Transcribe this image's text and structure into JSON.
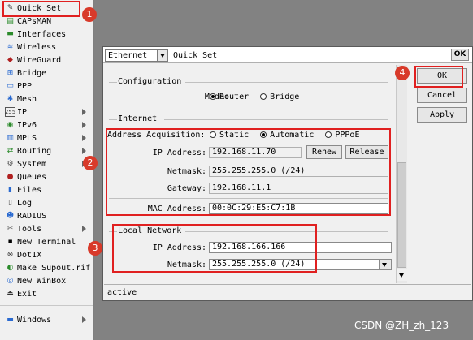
{
  "sidebar": {
    "items": [
      {
        "label": "Quick Set",
        "icon": "quickset-icon",
        "glyph": "✎",
        "color": "#333333",
        "arrow": false
      },
      {
        "label": "CAPsMAN",
        "icon": "capsman-icon",
        "glyph": "▤",
        "color": "#2a8a2a",
        "arrow": false
      },
      {
        "label": "Interfaces",
        "icon": "interfaces-icon",
        "glyph": "▬",
        "color": "#2a8a2a",
        "arrow": false
      },
      {
        "label": "Wireless",
        "icon": "wireless-icon",
        "glyph": "≋",
        "color": "#2a6ad0",
        "arrow": false
      },
      {
        "label": "WireGuard",
        "icon": "wireguard-icon",
        "glyph": "◆",
        "color": "#b02020",
        "arrow": false
      },
      {
        "label": "Bridge",
        "icon": "bridge-icon",
        "glyph": "⊞",
        "color": "#2a6ad0",
        "arrow": false
      },
      {
        "label": "PPP",
        "icon": "ppp-icon",
        "glyph": "▭",
        "color": "#2a6ad0",
        "arrow": false
      },
      {
        "label": "Mesh",
        "icon": "mesh-icon",
        "glyph": "✱",
        "color": "#2a6ad0",
        "arrow": false
      },
      {
        "label": "IP",
        "icon": "ip-icon",
        "glyph": "255",
        "color": "#333333",
        "arrow": true
      },
      {
        "label": "IPv6",
        "icon": "ipv6-icon",
        "glyph": "◉",
        "color": "#2a8a2a",
        "arrow": true
      },
      {
        "label": "MPLS",
        "icon": "mpls-icon",
        "glyph": "▥",
        "color": "#2a6ad0",
        "arrow": true
      },
      {
        "label": "Routing",
        "icon": "routing-icon",
        "glyph": "⇄",
        "color": "#2a8a2a",
        "arrow": true
      },
      {
        "label": "System",
        "icon": "system-icon",
        "glyph": "⚙",
        "color": "#555555",
        "arrow": true
      },
      {
        "label": "Queues",
        "icon": "queues-icon",
        "glyph": "●",
        "color": "#b02020",
        "arrow": false
      },
      {
        "label": "Files",
        "icon": "files-icon",
        "glyph": "▮",
        "color": "#2a6ad0",
        "arrow": false
      },
      {
        "label": "Log",
        "icon": "log-icon",
        "glyph": "▯",
        "color": "#555555",
        "arrow": false
      },
      {
        "label": "RADIUS",
        "icon": "radius-icon",
        "glyph": "☻",
        "color": "#2a6ad0",
        "arrow": false
      },
      {
        "label": "Tools",
        "icon": "tools-icon",
        "glyph": "✂",
        "color": "#555555",
        "arrow": true
      },
      {
        "label": "New Terminal",
        "icon": "terminal-icon",
        "glyph": "▪",
        "color": "#000000",
        "arrow": false
      },
      {
        "label": "Dot1X",
        "icon": "dot1x-icon",
        "glyph": "⊗",
        "color": "#333333",
        "arrow": false
      },
      {
        "label": "Make Supout.rif",
        "icon": "supout-icon",
        "glyph": "◐",
        "color": "#2a8a2a",
        "arrow": false
      },
      {
        "label": "New WinBox",
        "icon": "winbox-icon",
        "glyph": "◎",
        "color": "#2a6ad0",
        "arrow": false
      },
      {
        "label": "Exit",
        "icon": "exit-icon",
        "glyph": "⏏",
        "color": "#333333",
        "arrow": false
      },
      {
        "label": "Windows",
        "icon": "windows-icon",
        "glyph": "▬",
        "color": "#2a6ad0",
        "arrow": true
      }
    ]
  },
  "dialog": {
    "type_value": "Ethernet",
    "title": "Quick Set",
    "close_label": "OK",
    "configuration": {
      "header": "Configuration",
      "mode_label": "Mode:",
      "mode_options": [
        "Router",
        "Bridge"
      ],
      "mode_selected": "Router"
    },
    "internet": {
      "header": "Internet",
      "acq_label": "Address Acquisition:",
      "acq_options": [
        "Static",
        "Automatic",
        "PPPoE"
      ],
      "acq_selected": "Automatic",
      "ip_label": "IP Address:",
      "ip_value": "192.168.11.70",
      "renew_label": "Renew",
      "release_label": "Release",
      "netmask_label": "Netmask:",
      "netmask_value": "255.255.255.0 (/24)",
      "gateway_label": "Gateway:",
      "gateway_value": "192.168.11.1",
      "mac_label": "MAC Address:",
      "mac_value": "00:0C:29:E5:C7:1B"
    },
    "local": {
      "header": "Local Network",
      "ip_label": "IP Address:",
      "ip_value": "192.168.166.166",
      "netmask_label": "Netmask:",
      "netmask_value": "255.255.255.0 (/24)"
    },
    "buttons": {
      "ok": "OK",
      "cancel": "Cancel",
      "apply": "Apply"
    },
    "status": "active"
  },
  "annotations": {
    "badges": [
      "1",
      "2",
      "3",
      "4"
    ],
    "accent": "#e02020"
  },
  "watermark": "CSDN @ZH_zh_123"
}
